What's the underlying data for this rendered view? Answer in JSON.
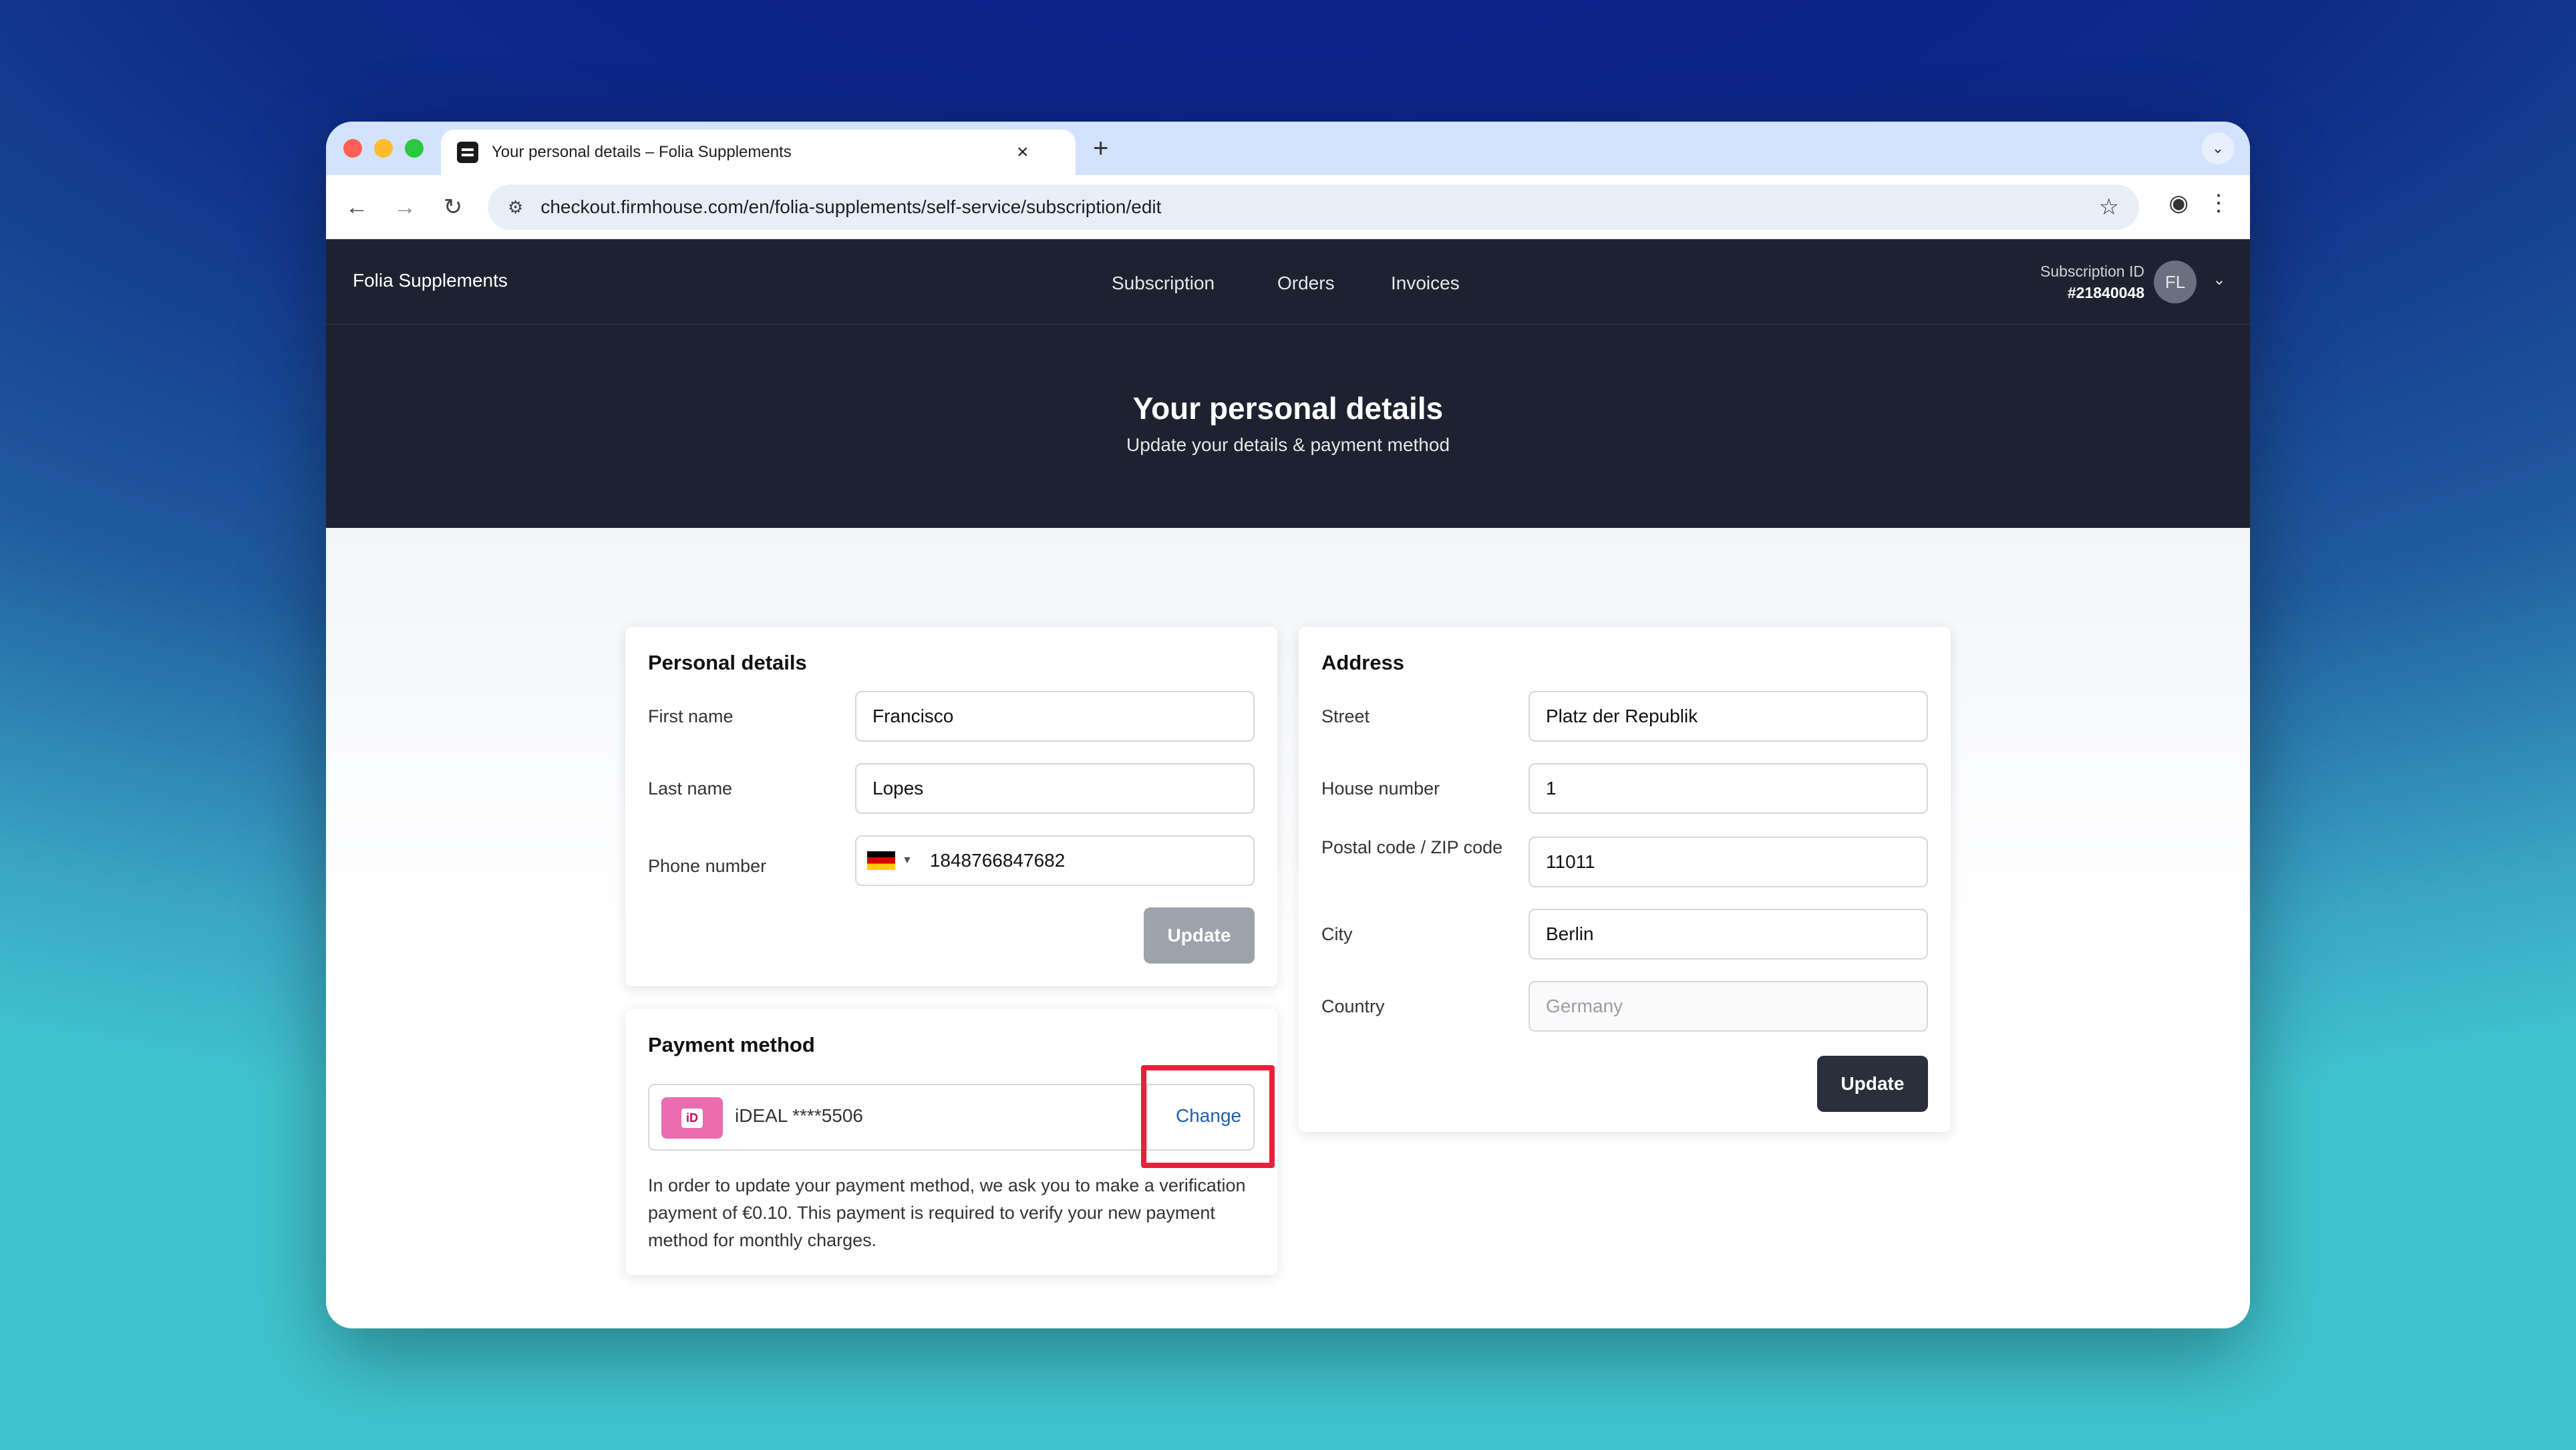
{
  "browser": {
    "tab_title": "Your personal details – Folia Supplements",
    "new_tab": "+",
    "close_tab": "×",
    "url": "checkout.firmhouse.com/en/folia-supplements/self-service/subscription/edit"
  },
  "nav": {
    "brand": "Folia Supplements",
    "links": [
      "Subscription",
      "Orders",
      "Invoices"
    ],
    "subscription_label": "Subscription ID",
    "subscription_id": "#21840048",
    "avatar_initials": "FL"
  },
  "hero": {
    "title": "Your personal details",
    "subtitle": "Update your details & payment method"
  },
  "personal": {
    "title": "Personal details",
    "first_name_label": "First name",
    "first_name_value": "Francisco",
    "last_name_label": "Last name",
    "last_name_value": "Lopes",
    "phone_label": "Phone number",
    "phone_value": "1848766847682",
    "update_label": "Update"
  },
  "address": {
    "title": "Address",
    "street_label": "Street",
    "street_value": "Platz der Republik",
    "house_label": "House number",
    "house_value": "1",
    "postal_label": "Postal code / ZIP code",
    "postal_value": "11011",
    "city_label": "City",
    "city_value": "Berlin",
    "country_label": "Country",
    "country_value": "Germany",
    "update_label": "Update"
  },
  "payment": {
    "title": "Payment method",
    "method_text": "iDEAL ****5506",
    "change_label": "Change",
    "note": "In order to update your payment method, we ask you to make a verification payment of €0.10. This payment is required to verify your new payment method for monthly charges."
  },
  "colors": {
    "hero_bg": "#1e2230",
    "disabled_button": "#9ea2ab",
    "primary_button": "#2b2f3c",
    "link": "#1f5fae",
    "highlight": "#e8203b"
  }
}
